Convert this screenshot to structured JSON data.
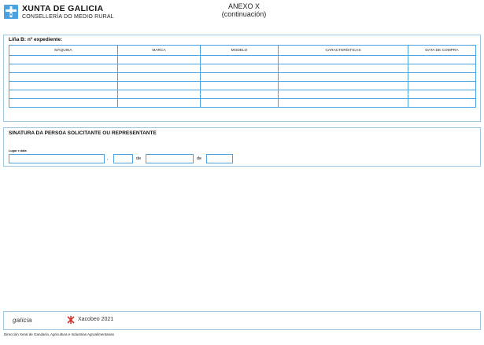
{
  "header": {
    "gov_title": "XUNTA DE GALICIA",
    "gov_subtitle": "CONSELLERÍA DO MEDIO RURAL",
    "annex_title": "ANEXO X",
    "annex_subtitle": "(continuación)"
  },
  "section_b": {
    "title": "Liña B: nº expediente:",
    "columns": [
      "MÁQUINA",
      "MARCA",
      "MODELO",
      "CARACTERÍSTICAS",
      "DATA DE COMPRA"
    ],
    "row_count": 6
  },
  "signature": {
    "title": "SINATURA DA PERSOA SOLICITANTE OU REPRESENTANTE",
    "place_date_label": "Lugar e data",
    "comma": ",",
    "de_1": "de",
    "de_2": "de",
    "place_value": "",
    "day_value": "",
    "month_value": "",
    "year_value": ""
  },
  "footer": {
    "galicia_logo": "galicia",
    "xacobeo_logo": "Xacobeo 2021",
    "department": "Dirección Xeral de Gandaría, Agricultura e Industrias Agroalimentarias"
  },
  "colors": {
    "accent": "#4aa3df",
    "border_light": "#9cc6e4"
  }
}
